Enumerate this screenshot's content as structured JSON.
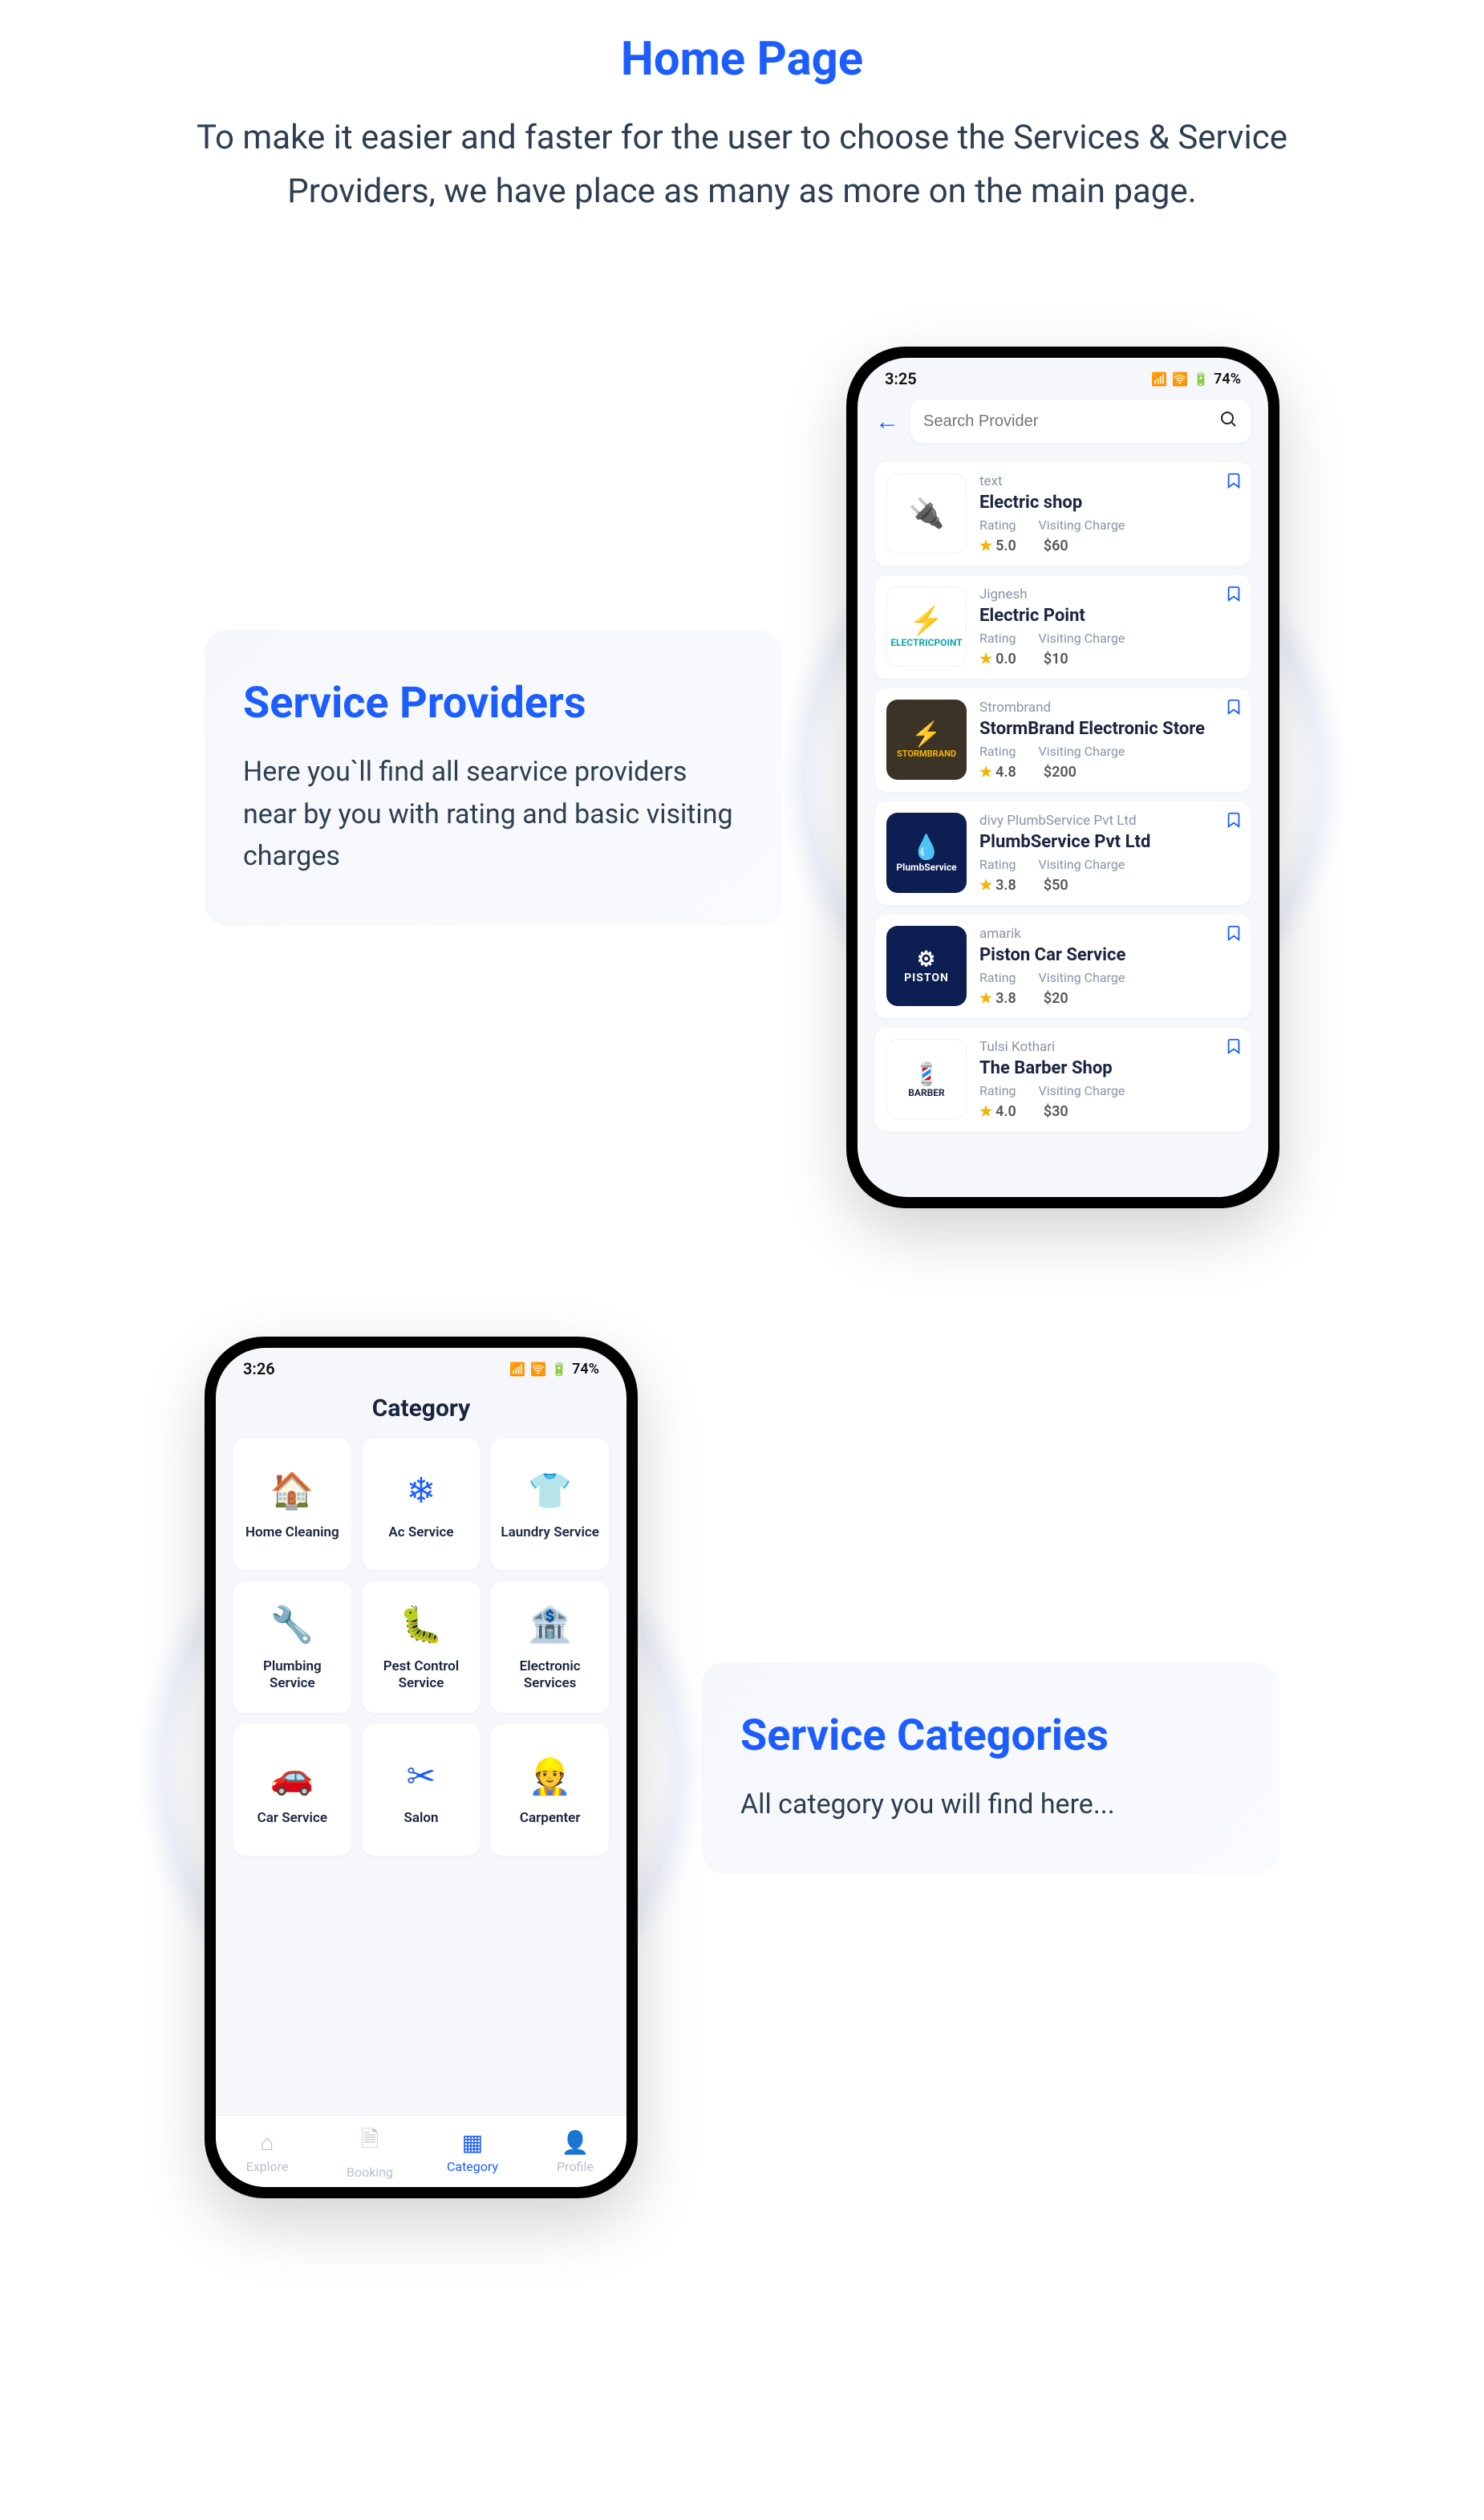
{
  "hero": {
    "title": "Home Page",
    "subtitle": "To make it easier and faster for the user to choose the Services  & Service Providers, we have place as many as more on the main page."
  },
  "section1": {
    "title": "Service Providers",
    "desc": "Here you`ll find all searvice providers near by you with rating and basic visiting charges"
  },
  "section2": {
    "title": "Service Categories",
    "desc": "All category you will find here..."
  },
  "status": {
    "time_a": "3:25",
    "time_b": "3:26",
    "battery": "74%"
  },
  "search": {
    "placeholder": "Search Provider"
  },
  "labels": {
    "rating": "Rating",
    "visiting": "Visiting Charge"
  },
  "providers": [
    {
      "owner": "text",
      "shop": "Electric shop",
      "rating": "5.0",
      "charge": "$60"
    },
    {
      "owner": "Jignesh",
      "shop": "Electric Point",
      "rating": "0.0",
      "charge": "$10"
    },
    {
      "owner": "Strombrand",
      "shop": "StormBrand Electronic Store",
      "rating": "4.8",
      "charge": "$200"
    },
    {
      "owner": "divy PlumbService Pvt Ltd",
      "shop": "PlumbService Pvt Ltd",
      "rating": "3.8",
      "charge": "$50"
    },
    {
      "owner": "amarik",
      "shop": "Piston Car Service",
      "rating": "3.8",
      "charge": "$20"
    },
    {
      "owner": "Tulsi Kothari",
      "shop": "The Barber Shop",
      "rating": "4.0",
      "charge": "$30"
    }
  ],
  "cat_header": "Category",
  "categories": [
    {
      "label": "Home Cleaning",
      "icon": "🏠"
    },
    {
      "label": "Ac Service",
      "icon": "❄"
    },
    {
      "label": "Laundry Service",
      "icon": "👕"
    },
    {
      "label": "Plumbing Service",
      "icon": "🔧"
    },
    {
      "label": "Pest Control Service",
      "icon": "🐛"
    },
    {
      "label": "Electronic Services",
      "icon": "🏦"
    },
    {
      "label": "Car Service",
      "icon": "🚗"
    },
    {
      "label": "Salon",
      "icon": "✂"
    },
    {
      "label": "Carpenter",
      "icon": "👷"
    }
  ],
  "nav": [
    {
      "label": "Explore",
      "icon": "⌂"
    },
    {
      "label": "Booking",
      "icon": "🗎"
    },
    {
      "label": "Category",
      "icon": "▦"
    },
    {
      "label": "Profile",
      "icon": "👤"
    }
  ]
}
